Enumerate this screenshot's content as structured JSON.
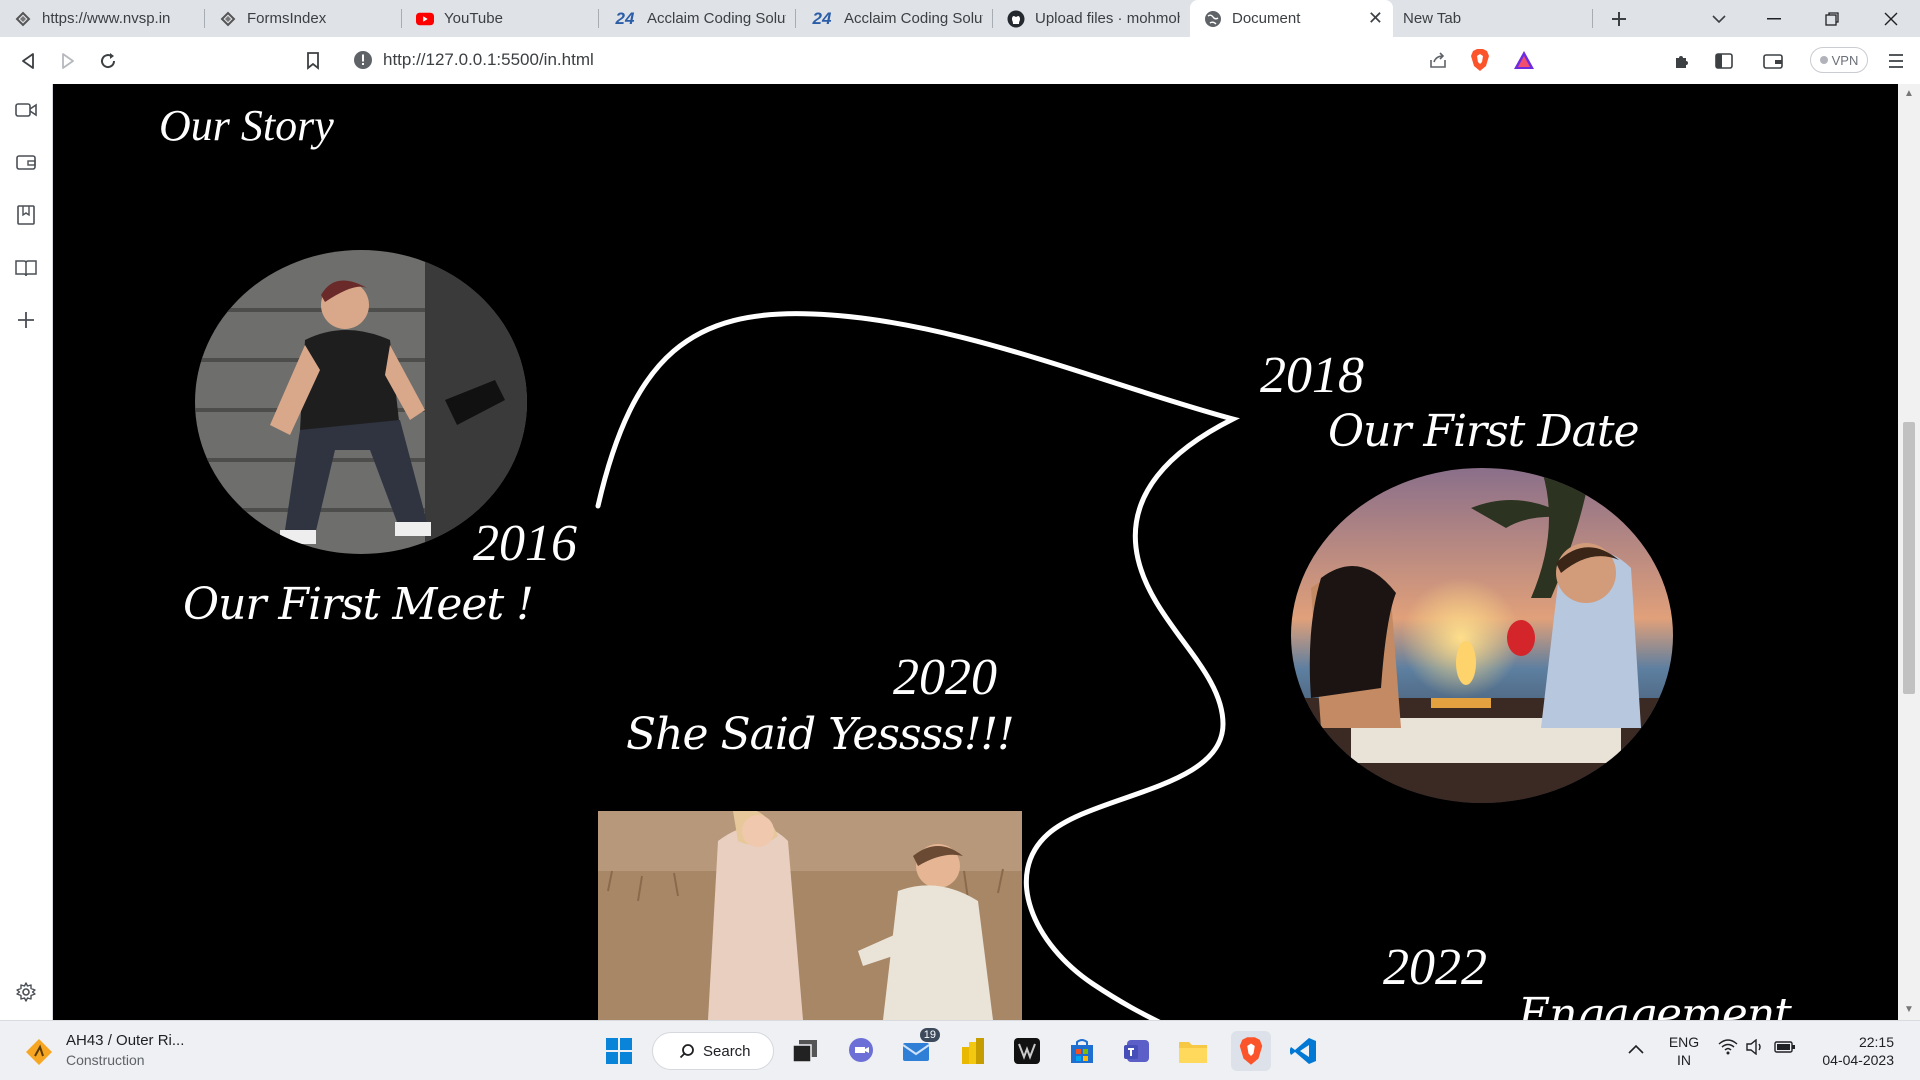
{
  "browser": {
    "tabs": [
      {
        "title": "https://www.nvsp.in",
        "icon": "nvsp-icon",
        "active": false
      },
      {
        "title": "FormsIndex",
        "icon": "forms-icon",
        "active": false
      },
      {
        "title": "YouTube",
        "icon": "youtube-icon",
        "active": false
      },
      {
        "title": "Acclaim Coding Solutic",
        "icon": "acclaim-icon",
        "active": false
      },
      {
        "title": "Acclaim Coding Solutic",
        "icon": "acclaim-icon",
        "active": false
      },
      {
        "title": "Upload files · mohmoh",
        "icon": "github-icon",
        "active": false
      },
      {
        "title": "Document",
        "icon": "globe-icon",
        "active": true
      },
      {
        "title": "New Tab",
        "icon": "",
        "active": false
      }
    ],
    "acclaim_badge": "24",
    "url": "http://127.0.0.1:5500/in.html",
    "vpn_label": "VPN"
  },
  "page": {
    "heading": "Our Story",
    "events": [
      {
        "year": "2016",
        "caption": "Our First Meet !"
      },
      {
        "year": "2018",
        "caption": "Our First Date"
      },
      {
        "year": "2020",
        "caption": "She Said Yessss!!!"
      },
      {
        "year": "2022",
        "caption": "Engagement"
      }
    ]
  },
  "taskbar": {
    "weather_title": "AH43 / Outer Ri...",
    "weather_sub": "Construction",
    "search_label": "Search",
    "mail_badge": "19",
    "lang_top": "ENG",
    "lang_bottom": "IN",
    "time": "22:15",
    "date": "04-04-2023"
  },
  "colors": {
    "page_bg": "#000000",
    "tabstrip_bg": "#dfe3e8",
    "brave_orange": "#fb542b",
    "vscode_blue": "#0078d4"
  }
}
